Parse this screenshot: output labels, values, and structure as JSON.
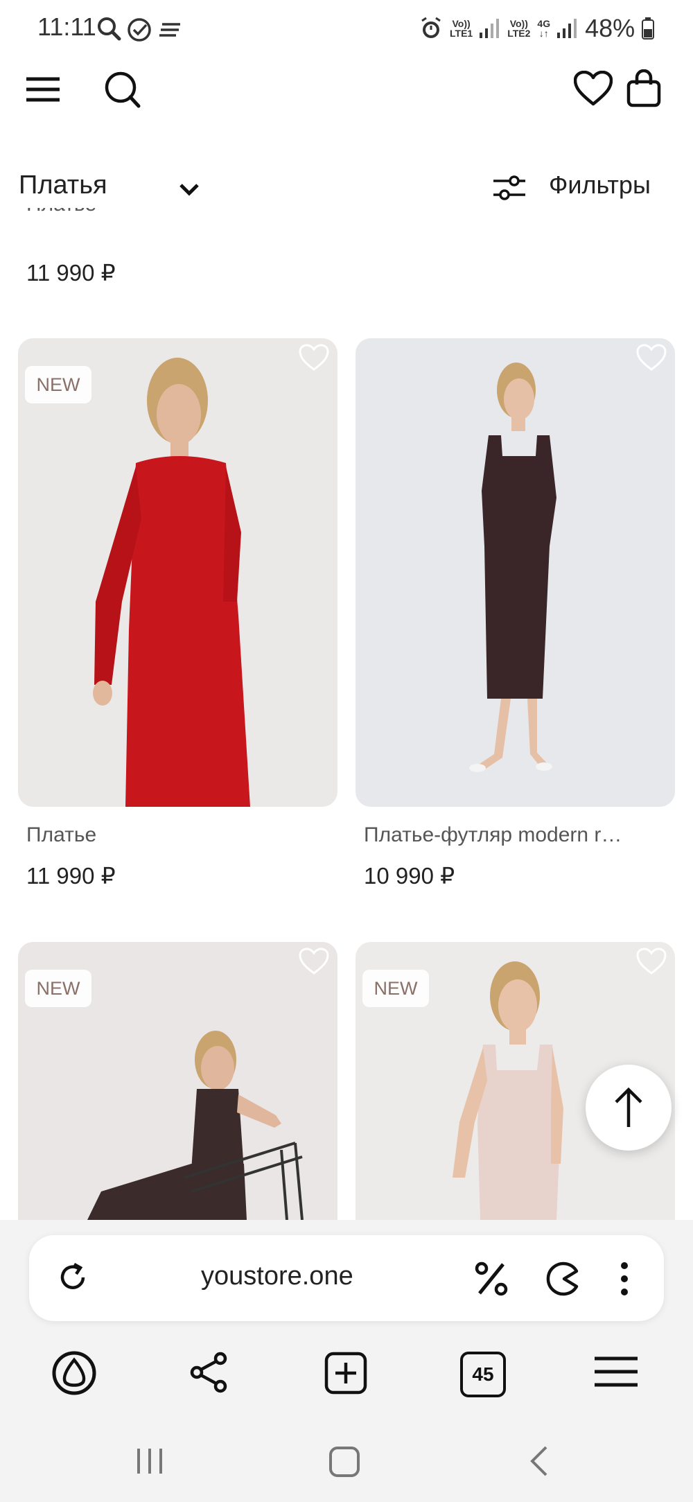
{
  "status_bar": {
    "time": "11:11",
    "sim1_label_top": "Vo))",
    "sim1_label_bottom": "LTE1",
    "sim2_label_top": "Vo))",
    "sim2_label_bottom": "LTE2",
    "network_type": "4G",
    "battery": "48%"
  },
  "header": {
    "icons": [
      "menu-icon",
      "search-icon",
      "heart-icon",
      "bag-icon"
    ]
  },
  "filter_bar": {
    "category": "Платья",
    "filters_label": "Фильтры"
  },
  "partial_item": {
    "name": "Платье",
    "price": "11 990 ₽"
  },
  "products": [
    {
      "badge": "NEW",
      "name": "Платье",
      "price": "11 990 ₽",
      "color": "#c8161d"
    },
    {
      "badge": "",
      "name": "Платье-футляр modern r…",
      "price": "10 990 ₽",
      "color": "#3a2528"
    },
    {
      "badge": "NEW",
      "name": "",
      "price": "",
      "color": "#3b2b2b"
    },
    {
      "badge": "NEW",
      "name": "",
      "price": "",
      "color": "#e7d2cc"
    }
  ],
  "browser": {
    "url": "youstore.one",
    "tabs_count": "45"
  },
  "colors": {
    "background": "#ffffff",
    "browser_bar": "#f3f3f3",
    "badge_text": "#8a7068"
  }
}
